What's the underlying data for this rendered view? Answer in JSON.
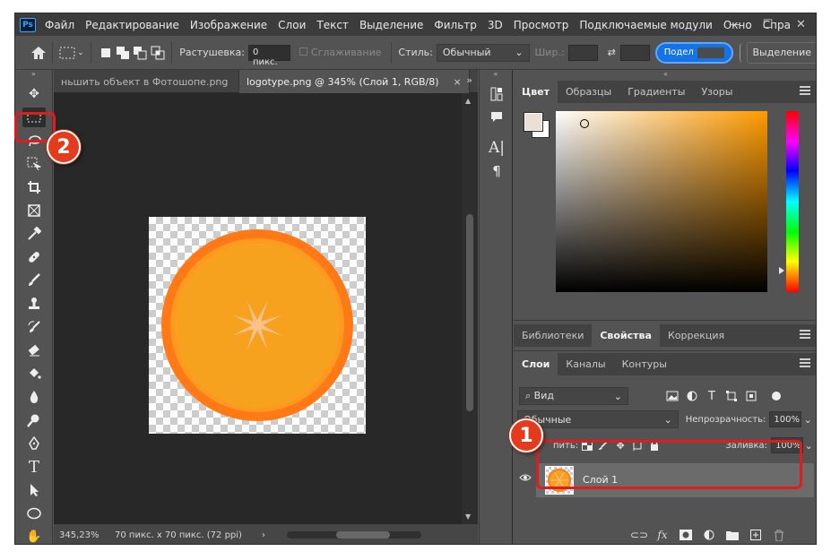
{
  "app": {
    "logo_text": "Ps"
  },
  "menu": [
    "Файл",
    "Редактирование",
    "Изображение",
    "Слои",
    "Текст",
    "Выделение",
    "Фильтр",
    "3D",
    "Просмотр",
    "Подключаемые модули",
    "Окно",
    "Спра"
  ],
  "window_controls": {
    "minimize": "—",
    "maximize": "☐",
    "close": "✕"
  },
  "options_bar": {
    "feather_label": "Растушевка:",
    "feather_value": "0 пикс.",
    "antialias_label": "Сглаживание",
    "style_label": "Стиль:",
    "style_value": "Обычный",
    "width_label": "Шир.:",
    "share_label": "Подел",
    "selection_label": "Выделение"
  },
  "document": {
    "tabs": [
      {
        "label": "ньшить объект в Фотошопе.png",
        "active": false
      },
      {
        "label": "logotype.png @ 345% (Слой 1, RGB/8)",
        "active": true
      }
    ],
    "tab_close": "×",
    "more": "»",
    "status": {
      "zoom": "345,23%",
      "info": "70 пикс. x 70 пикс. (72 ppi)",
      "arrow": "›"
    }
  },
  "panels": {
    "color_tabs": [
      "Цвет",
      "Образцы",
      "Градиенты",
      "Узоры"
    ],
    "props_tabs": [
      "Библиотеки",
      "Свойства",
      "Коррекция"
    ],
    "layers_tabs": [
      "Слои",
      "Каналы",
      "Контуры"
    ],
    "layers": {
      "filter_value": "Вид",
      "blend_mode": "Обычные",
      "opacity_label": "Непрозрачность:",
      "opacity_value": "100%",
      "lock_label": "пить:",
      "fill_label": "Заливка:",
      "fill_value": "100%",
      "items": [
        {
          "name": "Слой 1"
        }
      ]
    }
  },
  "annotations": {
    "callout_1": "1",
    "callout_2": "2"
  },
  "colors": {
    "accent": "#1473e6",
    "callout": "#e53a1b",
    "frame": "#e01c1c",
    "orange": "#ff8c1a",
    "foreground": "#e9dfd4"
  }
}
